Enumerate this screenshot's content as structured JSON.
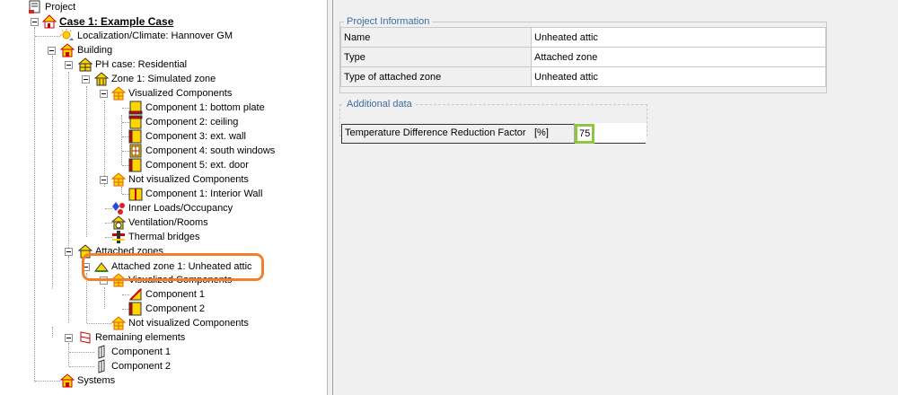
{
  "tree": {
    "project": "Project",
    "case": "Case 1: Example Case",
    "climate": "Localization/Climate: Hannover GM",
    "building": "Building",
    "ph_case": "PH case: Residential",
    "zone1": "Zone 1: Simulated zone",
    "visualized": "Visualized Components",
    "comp_bottom": "Component 1: bottom plate",
    "comp_ceiling": "Component 2: ceiling",
    "comp_wall": "Component 3: ext. wall",
    "comp_windows": "Component 4: south windows",
    "comp_door": "Component 5: ext. door",
    "not_visualized": "Not visualized Components",
    "comp_interior": "Component 1: Interior Wall",
    "inner_loads": "Inner Loads/Occupancy",
    "ventilation": "Ventilation/Rooms",
    "thermal": "Thermal bridges",
    "attached_zones": "Attached zones",
    "attached_zone1": "Attached zone 1: Unheated attic",
    "att_visualized": "Visualized Components",
    "att_comp1": "Component 1",
    "att_comp2": "Component 2",
    "att_not_visualized": "Not visualized Components",
    "remaining": "Remaining elements",
    "rem_comp1": "Component 1",
    "rem_comp2": "Component 2",
    "systems": "Systems"
  },
  "project_info": {
    "legend": "Project Information",
    "rows": [
      {
        "key": "Name",
        "value": "Unheated attic"
      },
      {
        "key": "Type",
        "value": "Attached zone"
      },
      {
        "key": "Type of attached zone",
        "value": "Unheated attic"
      }
    ]
  },
  "additional": {
    "legend": "Additional data",
    "label": "Temperature Difference Reduction Factor",
    "unit": "[%]",
    "value": "75"
  },
  "colors": {
    "accent_highlight": "#f0802a",
    "field_focus": "#8dc63f",
    "legend": "#3a6ea5"
  }
}
